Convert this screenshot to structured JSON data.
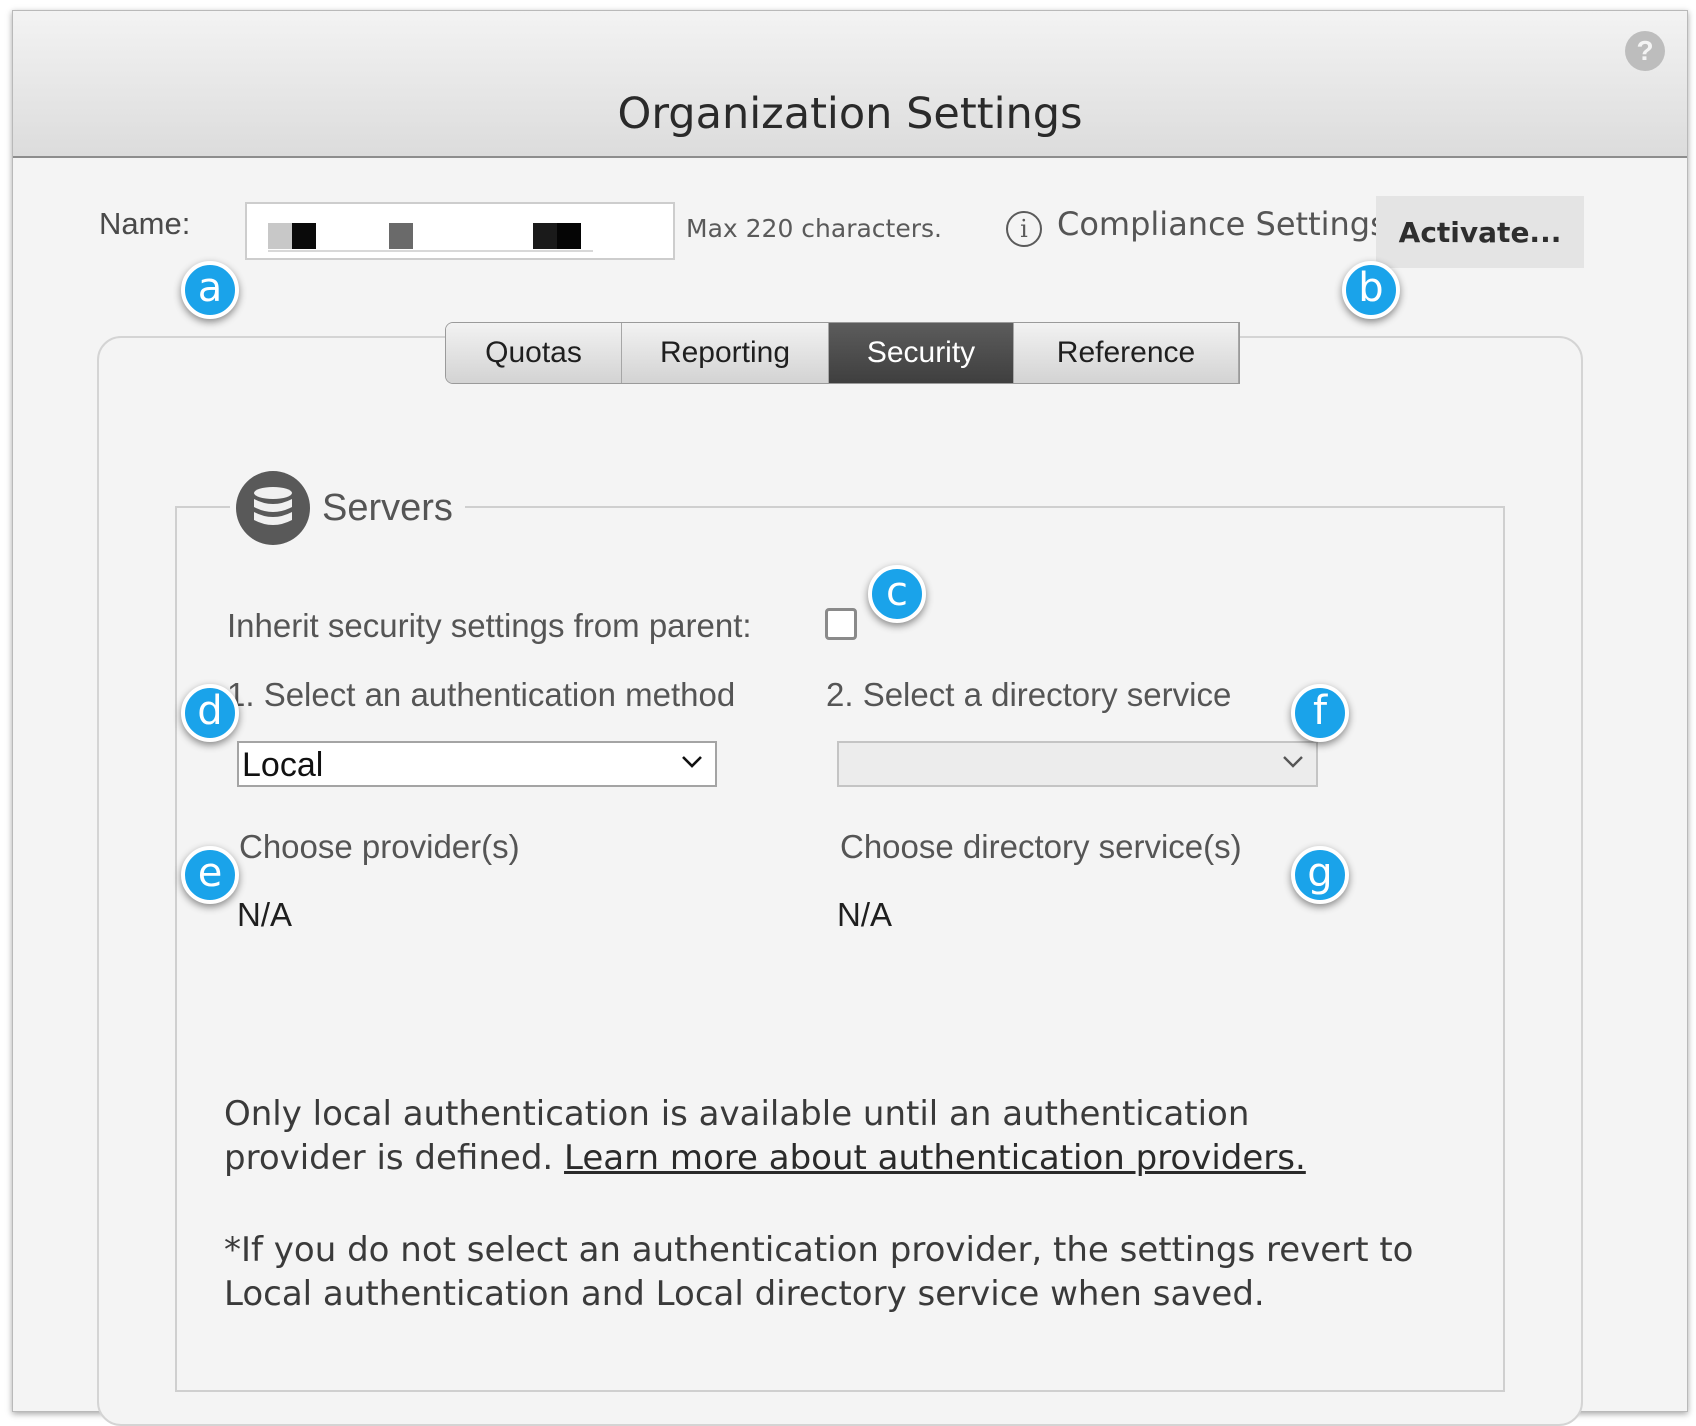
{
  "window": {
    "title": "Organization Settings",
    "help_icon": "?"
  },
  "name_row": {
    "label": "Name:",
    "value_redacted": true,
    "hint": "Max 220 characters.",
    "compliance_label": "Compliance Settings:",
    "info_icon": "i",
    "activate_label": "Activate..."
  },
  "tabs": [
    {
      "label": "Quotas",
      "active": false
    },
    {
      "label": "Reporting",
      "active": false
    },
    {
      "label": "Security",
      "active": true
    },
    {
      "label": "Reference",
      "active": false
    }
  ],
  "servers": {
    "title": "Servers",
    "inherit_label": "Inherit security settings from parent:",
    "inherit_checked": false,
    "auth_method_label": "1. Select an authentication method",
    "auth_method_value": "Local",
    "directory_label": "2. Select a directory service",
    "directory_value": "",
    "providers_label": "Choose provider(s)",
    "providers_value": "N/A",
    "directory_services_label": "Choose directory service(s)",
    "directory_services_value": "N/A",
    "info_text": "Only local authentication is available until an authentication provider is defined.",
    "info_link": "Learn more about authentication providers.",
    "note_text": "*If you do not select an authentication provider, the settings revert to Local authentication and Local directory service when saved."
  },
  "callouts": [
    "a",
    "b",
    "c",
    "d",
    "e",
    "f",
    "g"
  ],
  "colors": {
    "callout": "#1aa3ea",
    "active_tab": "#4a4a4a"
  }
}
